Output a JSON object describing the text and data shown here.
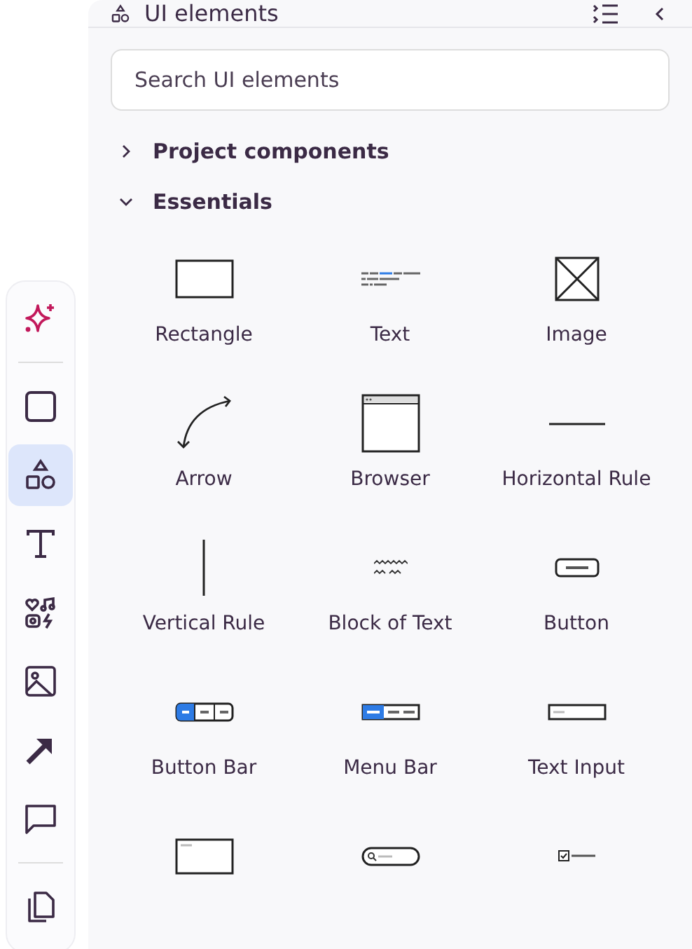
{
  "toolbar": {
    "tools": [
      {
        "kind": "sparkle",
        "selected": false
      },
      {
        "kind": "divider"
      },
      {
        "kind": "square",
        "selected": false
      },
      {
        "kind": "shapes",
        "selected": true
      },
      {
        "kind": "text",
        "selected": false
      },
      {
        "kind": "icons",
        "selected": false
      },
      {
        "kind": "image",
        "selected": false
      },
      {
        "kind": "arrow",
        "selected": false
      },
      {
        "kind": "comment",
        "selected": false
      },
      {
        "kind": "divider"
      },
      {
        "kind": "pages",
        "selected": false
      }
    ]
  },
  "panel": {
    "title": "UI elements",
    "search": {
      "placeholder": "Search UI elements"
    },
    "sections": [
      {
        "label": "Project components",
        "expanded": false
      },
      {
        "label": "Essentials",
        "expanded": true,
        "items": [
          {
            "kind": "rectangle",
            "label": "Rectangle"
          },
          {
            "kind": "text",
            "label": "Text"
          },
          {
            "kind": "image",
            "label": "Image"
          },
          {
            "kind": "arrow",
            "label": "Arrow"
          },
          {
            "kind": "browser",
            "label": "Browser"
          },
          {
            "kind": "hrule",
            "label": "Horizontal Rule"
          },
          {
            "kind": "vrule",
            "label": "Vertical Rule"
          },
          {
            "kind": "block",
            "label": "Block of Text"
          },
          {
            "kind": "button",
            "label": "Button"
          },
          {
            "kind": "buttonbar",
            "label": "Button Bar"
          },
          {
            "kind": "menubar",
            "label": "Menu Bar"
          },
          {
            "kind": "textinput",
            "label": "Text Input"
          },
          {
            "kind": "textarea"
          },
          {
            "kind": "search"
          },
          {
            "kind": "checkbox"
          }
        ]
      }
    ]
  }
}
